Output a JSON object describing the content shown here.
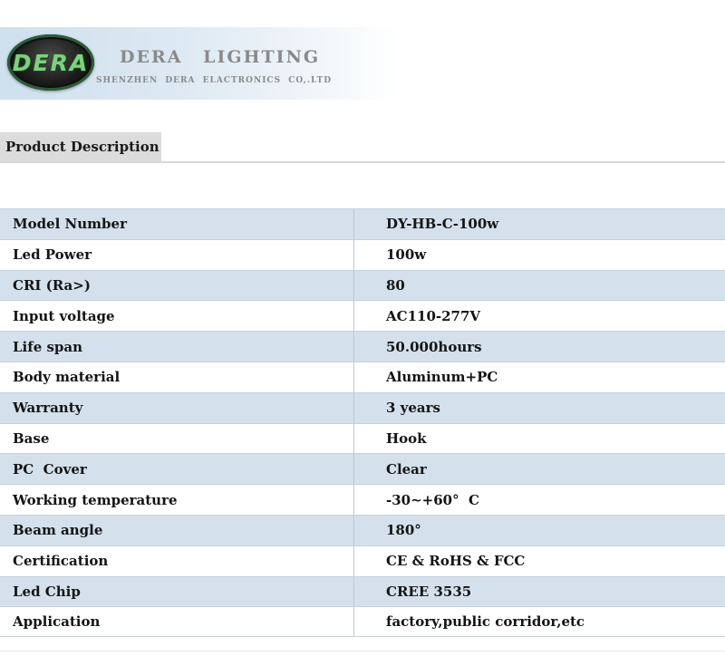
{
  "header": {
    "logo_text": "DERA",
    "brand_title": "DERA LIGHTING",
    "brand_subtitle": "SHENZHEN DERA ELACTRONICS CO,.LTD"
  },
  "section": {
    "title": "Product Description"
  },
  "specs": [
    {
      "label": "Model Number",
      "value": "DY-HB-C-100w"
    },
    {
      "label": "Led Power",
      "value": "100w"
    },
    {
      "label": "CRI (Ra>)",
      "value": "80"
    },
    {
      "label": "Input voltage",
      "value": "AC110-277V"
    },
    {
      "label": "Life span",
      "value": "50.000hours"
    },
    {
      "label": "Body material",
      "value": "Aluminum+PC"
    },
    {
      "label": "Warranty",
      "value": "3 years"
    },
    {
      "label": "Base",
      "value": "Hook"
    },
    {
      "label": "PC  Cover",
      "value": "Clear"
    },
    {
      "label": "Working temperature",
      "value": "-30~+60°  C"
    },
    {
      "label": "Beam angle",
      "value": "180°"
    },
    {
      "label": "Certification",
      "value": "CE & RoHS & FCC"
    },
    {
      "label": "Led Chip",
      "value": "CREE 3535"
    },
    {
      "label": "Application",
      "value": "factory,public corridor,etc"
    }
  ]
}
